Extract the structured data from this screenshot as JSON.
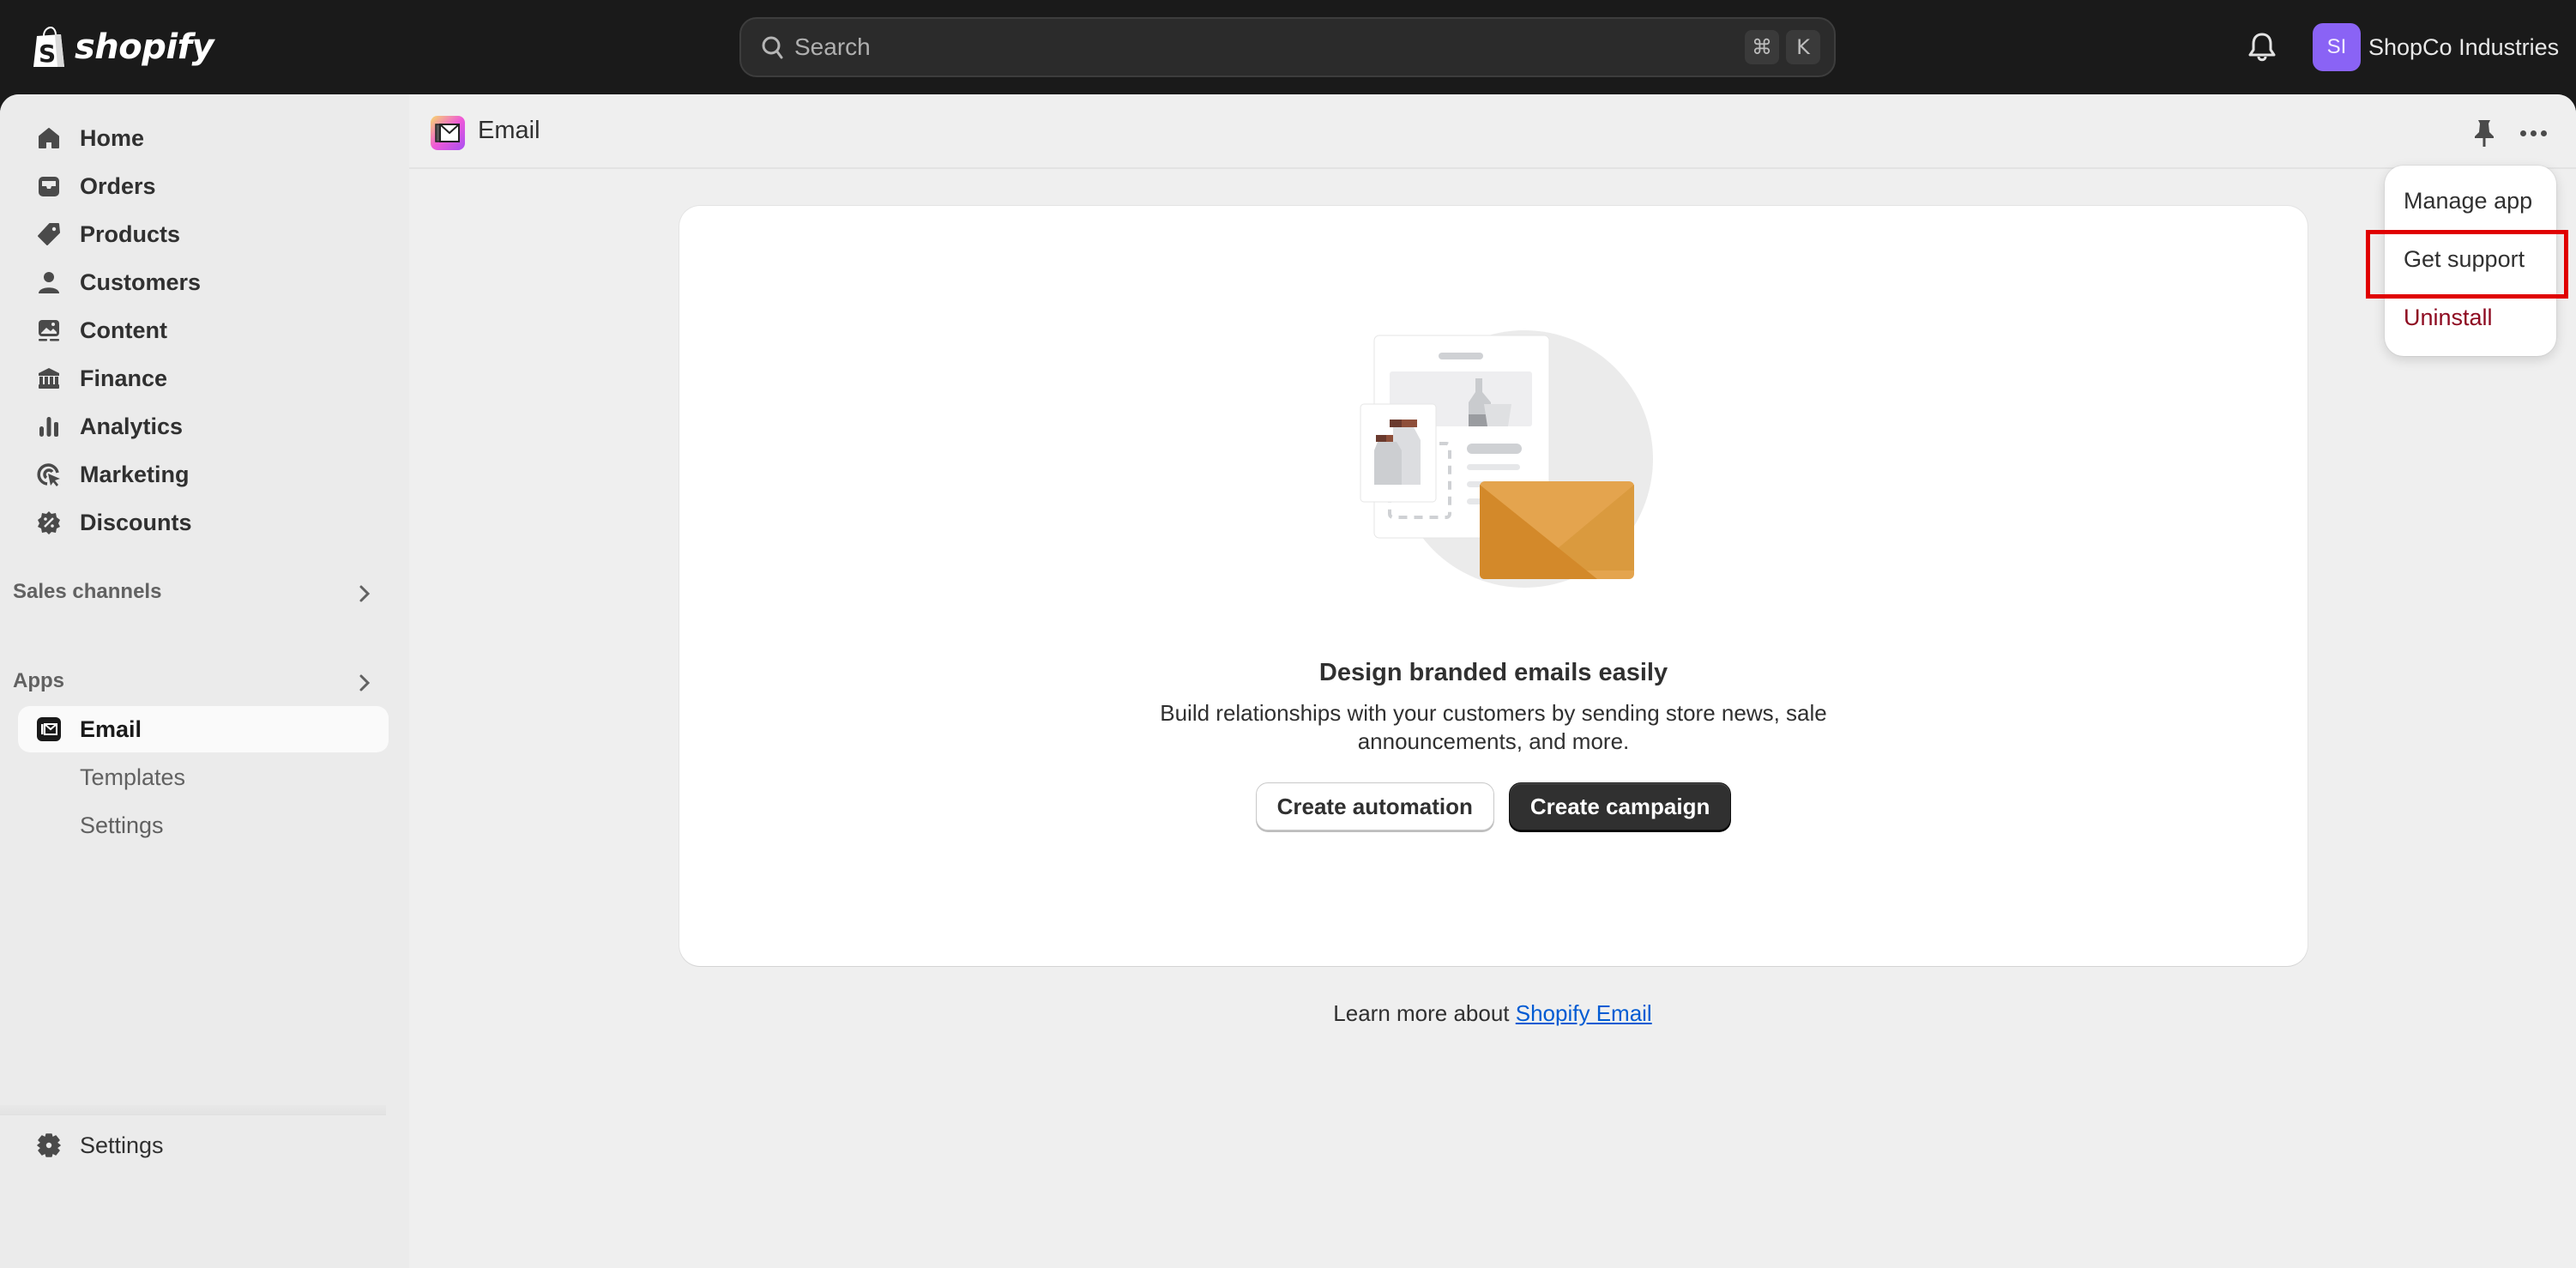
{
  "topbar": {
    "brand": "shopify",
    "search": {
      "placeholder": "Search",
      "shortcut_keys": [
        "⌘",
        "K"
      ]
    },
    "account": {
      "initials": "SI",
      "store_name": "ShopCo Industries",
      "avatar_color": "#8a63f5"
    }
  },
  "sidebar": {
    "items": [
      {
        "label": "Home",
        "icon": "home-icon"
      },
      {
        "label": "Orders",
        "icon": "orders-icon"
      },
      {
        "label": "Products",
        "icon": "tag-icon"
      },
      {
        "label": "Customers",
        "icon": "person-icon"
      },
      {
        "label": "Content",
        "icon": "image-icon"
      },
      {
        "label": "Finance",
        "icon": "bank-icon"
      },
      {
        "label": "Analytics",
        "icon": "bar-chart-icon"
      },
      {
        "label": "Marketing",
        "icon": "target-icon"
      },
      {
        "label": "Discounts",
        "icon": "discount-icon"
      }
    ],
    "sales_channels_label": "Sales channels",
    "apps_label": "Apps",
    "apps": [
      {
        "label": "Email",
        "icon": "email-icon",
        "active": true
      },
      {
        "label": "Templates"
      },
      {
        "label": "Settings"
      }
    ],
    "settings_label": "Settings"
  },
  "page": {
    "title": "Email",
    "card": {
      "title": "Design branded emails easily",
      "description": "Build relationships with your customers by sending store news, sale announcements, and more.",
      "secondary_button": "Create automation",
      "primary_button": "Create campaign"
    },
    "learn_more": {
      "prefix": "Learn more about ",
      "link": "Shopify Email"
    }
  },
  "menu": {
    "items": [
      {
        "label": "Manage app"
      },
      {
        "label": "Get support",
        "highlighted": true
      },
      {
        "label": "Uninstall",
        "destructive": true
      }
    ]
  },
  "colors": {
    "topbar": "#1a1a1a",
    "highlight": "#e00000",
    "link": "#005bd3",
    "destructive": "#8e0b21",
    "envelope": "#e2a24a"
  }
}
